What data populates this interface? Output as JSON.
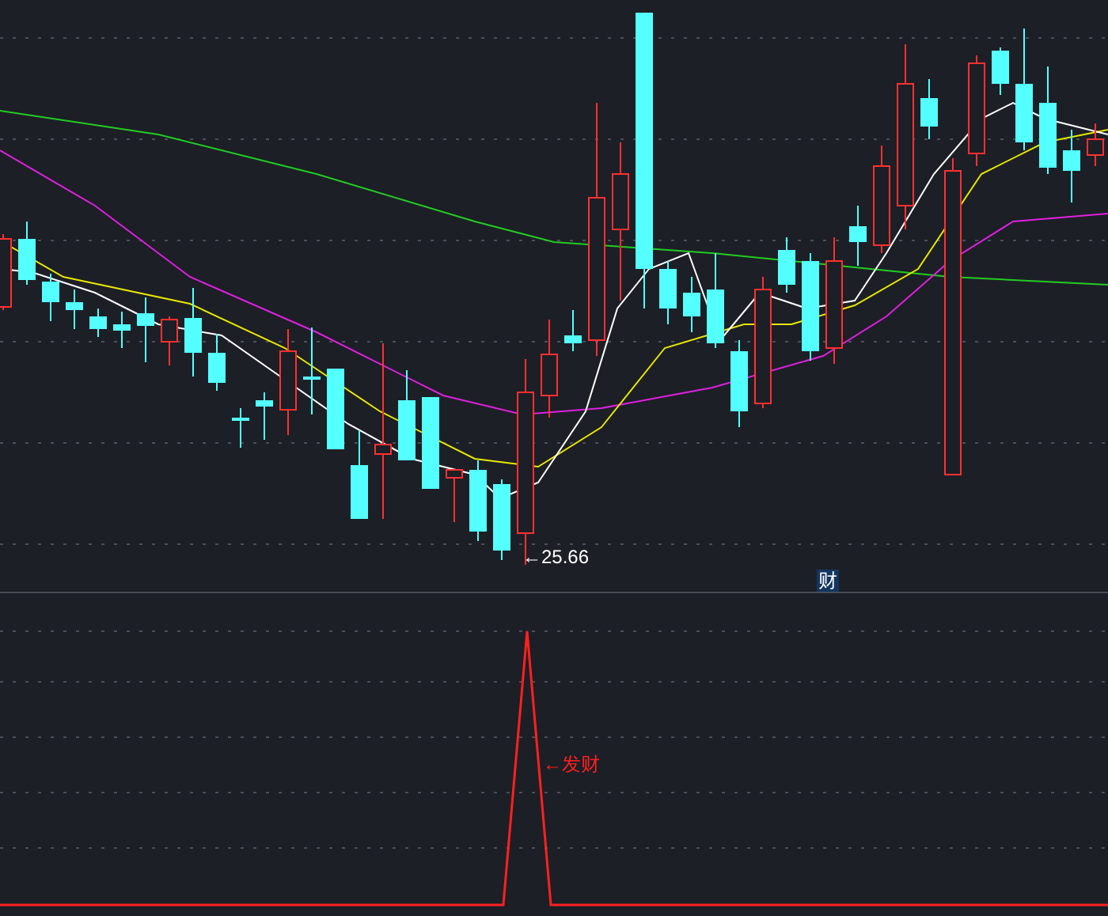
{
  "main_chart": {
    "low_label": "←25.66",
    "signal_marker": "财"
  },
  "indicator_chart": {
    "signal_label": "←发财"
  }
}
